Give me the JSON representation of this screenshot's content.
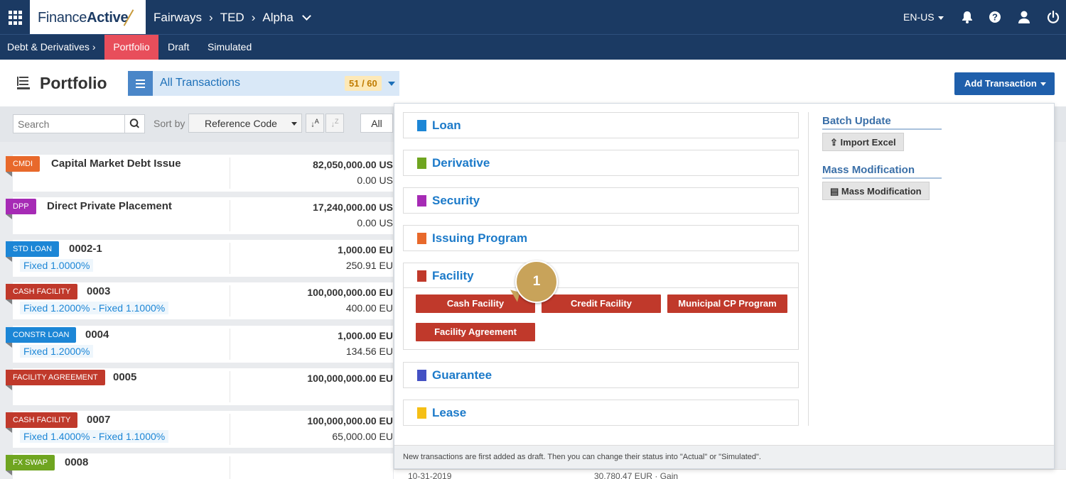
{
  "topbar": {
    "logo_regular": "Finance",
    "logo_bold": "Active",
    "breadcrumb": [
      "Fairways",
      "TED",
      "Alpha"
    ],
    "language": "EN-US",
    "icons": [
      "apps-grid-icon",
      "bell-icon",
      "help-icon",
      "user-icon",
      "power-icon"
    ]
  },
  "subnav": {
    "section": "Debt & Derivatives",
    "tabs": [
      "Portfolio",
      "Draft",
      "Simulated"
    ],
    "active_tab": "Portfolio"
  },
  "header": {
    "title": "Portfolio",
    "selector_label": "All Transactions",
    "selector_count": "51 / 60",
    "add_button": "Add Transaction"
  },
  "toolbar": {
    "search_placeholder": "Search",
    "sort_label": "Sort by",
    "sort_value": "Reference Code",
    "filter_all": "All"
  },
  "rows": [
    {
      "tag": "CMDI",
      "tag_color": "#e8692b",
      "name": "Capital Market Debt Issue",
      "rate": "",
      "amount": "82,050,000.00 US",
      "amount2": "0.00 US"
    },
    {
      "tag": "DPP",
      "tag_color": "#a62bb5",
      "name": "Direct Private Placement",
      "rate": "",
      "amount": "17,240,000.00 US",
      "amount2": "0.00 US"
    },
    {
      "tag": "STD LOAN",
      "tag_color": "#1c86d6",
      "name": "0002-1",
      "rate": "Fixed 1.0000%",
      "amount": "1,000.00 EU",
      "amount2": "250.91 EU"
    },
    {
      "tag": "CASH FACILITY",
      "tag_color": "#c0392b",
      "name": "0003",
      "rate": "Fixed 1.2000% - Fixed 1.1000%",
      "amount": "100,000,000.00 EU",
      "amount2": "400.00 EU"
    },
    {
      "tag": "CONSTR LOAN",
      "tag_color": "#1c86d6",
      "name": "0004",
      "rate": "Fixed 1.2000%",
      "amount": "1,000.00 EU",
      "amount2": "134.56 EU"
    },
    {
      "tag": "FACILITY AGREEMENT",
      "tag_color": "#c0392b",
      "name": "0005",
      "rate": "",
      "amount": "100,000,000.00 EU",
      "amount2": ""
    },
    {
      "tag": "CASH FACILITY",
      "tag_color": "#c0392b",
      "name": "0007",
      "rate": "Fixed 1.4000% - Fixed 1.1000%",
      "amount": "100,000,000.00 EU",
      "amount2": "65,000.00 EU"
    },
    {
      "tag": "FX SWAP",
      "tag_color": "#6fa520",
      "name": "0008",
      "rate": "",
      "amount": "",
      "amount2": ""
    }
  ],
  "panel": {
    "categories": [
      {
        "name": "Loan",
        "color": "#1c86d6"
      },
      {
        "name": "Derivative",
        "color": "#6fa520"
      },
      {
        "name": "Security",
        "color": "#a62bb5"
      },
      {
        "name": "Issuing Program",
        "color": "#e8692b"
      },
      {
        "name": "Facility",
        "color": "#c0392b"
      },
      {
        "name": "Guarantee",
        "color": "#4451c4"
      },
      {
        "name": "Lease",
        "color": "#f5bf16"
      }
    ],
    "facility_buttons": [
      "Cash Facility",
      "Credit Facility",
      "Municipal CP Program",
      "Facility Agreement"
    ],
    "batch_title": "Batch Update",
    "import_button": "Import Excel",
    "mass_title": "Mass Modification",
    "mass_button": "Mass Modification",
    "footer_note": "New transactions are first added as draft. Then you can change their status into \"Actual\" or \"Simulated\"."
  },
  "callout": {
    "number": "1"
  },
  "peek": {
    "date": "10-31-2019",
    "amount": "30,780.47 EUR · Gain"
  }
}
